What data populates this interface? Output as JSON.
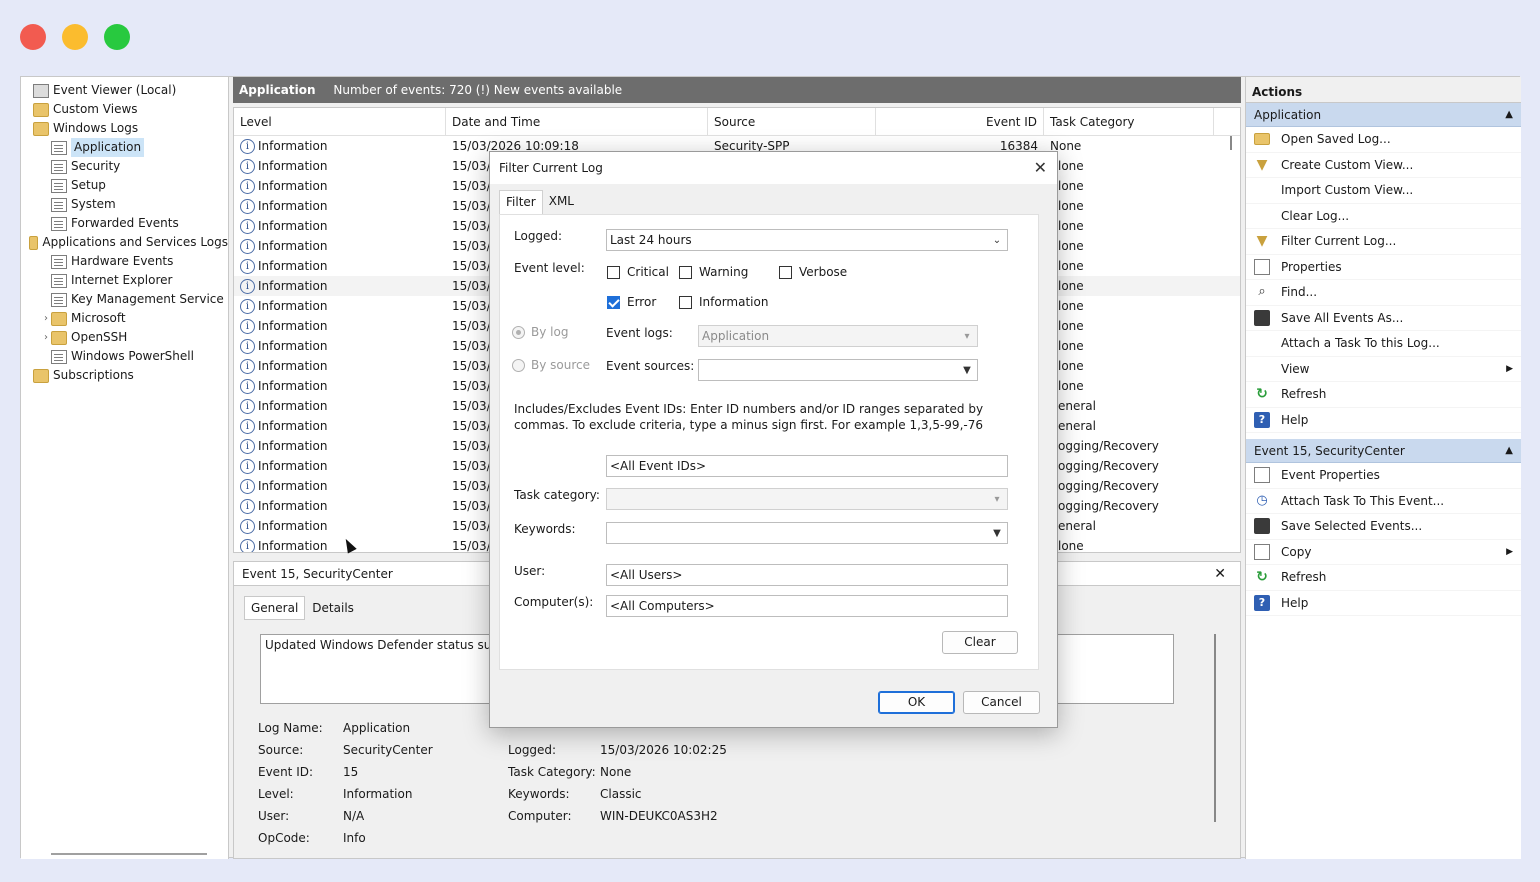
{
  "window": {
    "colors": {
      "close": "#f25b50",
      "minimize": "#fbbc2e",
      "maximize": "#28c93f"
    }
  },
  "tree": {
    "items": [
      {
        "label": "Event Viewer (Local)",
        "level": 0,
        "icon": "event-viewer-icon"
      },
      {
        "label": "Custom Views",
        "level": 0,
        "icon": "folder-icon"
      },
      {
        "label": "Windows Logs",
        "level": 0,
        "icon": "folder-icon"
      },
      {
        "label": "Application",
        "level": 1,
        "icon": "log-icon",
        "selected": true
      },
      {
        "label": "Security",
        "level": 1,
        "icon": "log-icon"
      },
      {
        "label": "Setup",
        "level": 1,
        "icon": "log-icon"
      },
      {
        "label": "System",
        "level": 1,
        "icon": "log-icon"
      },
      {
        "label": "Forwarded Events",
        "level": 1,
        "icon": "log-icon"
      },
      {
        "label": "Applications and Services Logs",
        "level": 0,
        "icon": "folder-icon"
      },
      {
        "label": "Hardware Events",
        "level": 1,
        "icon": "log-icon"
      },
      {
        "label": "Internet Explorer",
        "level": 1,
        "icon": "log-icon"
      },
      {
        "label": "Key Management Service",
        "level": 1,
        "icon": "log-icon"
      },
      {
        "label": "Microsoft",
        "level": 1,
        "icon": "folder-icon",
        "chevron": "›"
      },
      {
        "label": "OpenSSH",
        "level": 1,
        "icon": "folder-icon",
        "chevron": "›"
      },
      {
        "label": "Windows PowerShell",
        "level": 1,
        "icon": "log-icon"
      },
      {
        "label": "Subscriptions",
        "level": 0,
        "icon": "folder-icon"
      }
    ]
  },
  "header": {
    "title": "Application",
    "subtitle": "Number of events: 720 (!) New events available"
  },
  "grid": {
    "columns": [
      "Level",
      "Date and Time",
      "Source",
      "Event ID",
      "Task Category"
    ],
    "rows": [
      {
        "level": "Information",
        "date": "15/03/2026 10:09:18",
        "source": "Security-SPP",
        "id": "16384",
        "task": "None"
      },
      {
        "level": "Information",
        "date": "15/03/",
        "task": "lone"
      },
      {
        "level": "Information",
        "date": "15/03/",
        "task": "lone"
      },
      {
        "level": "Information",
        "date": "15/03/",
        "task": "lone"
      },
      {
        "level": "Information",
        "date": "15/03/",
        "task": "lone"
      },
      {
        "level": "Information",
        "date": "15/03/",
        "task": "lone"
      },
      {
        "level": "Information",
        "date": "15/03/",
        "task": "lone"
      },
      {
        "level": "Information",
        "date": "15/03/",
        "task": "lone",
        "selected": true
      },
      {
        "level": "Information",
        "date": "15/03/",
        "task": "lone"
      },
      {
        "level": "Information",
        "date": "15/03/",
        "task": "lone"
      },
      {
        "level": "Information",
        "date": "15/03/",
        "task": "lone"
      },
      {
        "level": "Information",
        "date": "15/03/",
        "task": "lone"
      },
      {
        "level": "Information",
        "date": "15/03/",
        "task": "lone"
      },
      {
        "level": "Information",
        "date": "15/03/",
        "task": "eneral"
      },
      {
        "level": "Information",
        "date": "15/03/",
        "task": "eneral"
      },
      {
        "level": "Information",
        "date": "15/03/",
        "task": "ogging/Recovery"
      },
      {
        "level": "Information",
        "date": "15/03/",
        "task": "ogging/Recovery"
      },
      {
        "level": "Information",
        "date": "15/03/",
        "task": "ogging/Recovery"
      },
      {
        "level": "Information",
        "date": "15/03/",
        "task": "ogging/Recovery"
      },
      {
        "level": "Information",
        "date": "15/03/",
        "task": "eneral"
      },
      {
        "level": "Information",
        "date": "15/03/",
        "task": "lone"
      }
    ]
  },
  "detail": {
    "title": "Event 15, SecurityCenter",
    "close": "✕",
    "tabs": [
      "General",
      "Details"
    ],
    "description": "Updated Windows Defender status succe",
    "left": [
      {
        "label": "Log Name:",
        "value": "Application"
      },
      {
        "label": "Source:",
        "value": "SecurityCenter"
      },
      {
        "label": "Event ID:",
        "value": "15"
      },
      {
        "label": "Level:",
        "value": "Information"
      },
      {
        "label": "User:",
        "value": "N/A"
      },
      {
        "label": "OpCode:",
        "value": "Info"
      }
    ],
    "right": [
      {
        "label": "Logged:",
        "value": "15/03/2026 10:02:25"
      },
      {
        "label": "Task Category:",
        "value": "None"
      },
      {
        "label": "Keywords:",
        "value": "Classic"
      },
      {
        "label": "Computer:",
        "value": "WIN-DEUKC0AS3H2"
      }
    ]
  },
  "actions": {
    "title": "Actions",
    "group1": "Application",
    "items1": [
      {
        "label": "Open Saved Log...",
        "icon": "folder-icon"
      },
      {
        "label": "Create Custom View...",
        "icon": "filter-icon"
      },
      {
        "label": "Import Custom View...",
        "icon": "blank"
      },
      {
        "label": "Clear Log...",
        "icon": "blank"
      },
      {
        "label": "Filter Current Log...",
        "icon": "filter-icon"
      },
      {
        "label": "Properties",
        "icon": "properties-icon"
      },
      {
        "label": "Find...",
        "icon": "find-icon"
      },
      {
        "label": "Save All Events As...",
        "icon": "save-icon"
      },
      {
        "label": "Attach a Task To this Log...",
        "icon": "blank"
      },
      {
        "label": "View",
        "icon": "blank",
        "submenu": true
      },
      {
        "label": "Refresh",
        "icon": "refresh-icon"
      },
      {
        "label": "Help",
        "icon": "help-icon"
      }
    ],
    "group2": "Event 15, SecurityCenter",
    "items2": [
      {
        "label": "Event Properties",
        "icon": "properties-icon"
      },
      {
        "label": "Attach Task To This Event...",
        "icon": "task-icon"
      },
      {
        "label": "Save Selected Events...",
        "icon": "save-icon"
      },
      {
        "label": "Copy",
        "icon": "copy-icon",
        "submenu": true
      },
      {
        "label": "Refresh",
        "icon": "refresh-icon"
      },
      {
        "label": "Help",
        "icon": "help-icon"
      }
    ]
  },
  "dialog": {
    "title": "Filter Current Log",
    "close": "✕",
    "tabs": [
      "Filter",
      "XML"
    ],
    "logged_label": "Logged:",
    "logged_value": "Last 24 hours",
    "event_level_label": "Event level:",
    "levels": [
      {
        "label": "Critical",
        "checked": false
      },
      {
        "label": "Warning",
        "checked": false
      },
      {
        "label": "Verbose",
        "checked": false
      },
      {
        "label": "Error",
        "checked": true
      },
      {
        "label": "Information",
        "checked": false
      }
    ],
    "by_log": "By log",
    "by_source": "By source",
    "event_logs_label": "Event logs:",
    "event_logs_value": "Application",
    "event_sources_label": "Event sources:",
    "event_sources_value": "",
    "help_text": "Includes/Excludes Event IDs: Enter ID numbers and/or ID ranges separated by commas. To exclude criteria, type a minus sign first. For example 1,3,5-99,-76",
    "event_ids_value": "<All Event IDs>",
    "task_category_label": "Task category:",
    "task_category_value": "",
    "keywords_label": "Keywords:",
    "keywords_value": "",
    "user_label": "User:",
    "user_value": "<All Users>",
    "computer_label": "Computer(s):",
    "computer_value": "<All Computers>",
    "clear_label": "Clear",
    "ok_label": "OK",
    "cancel_label": "Cancel"
  }
}
